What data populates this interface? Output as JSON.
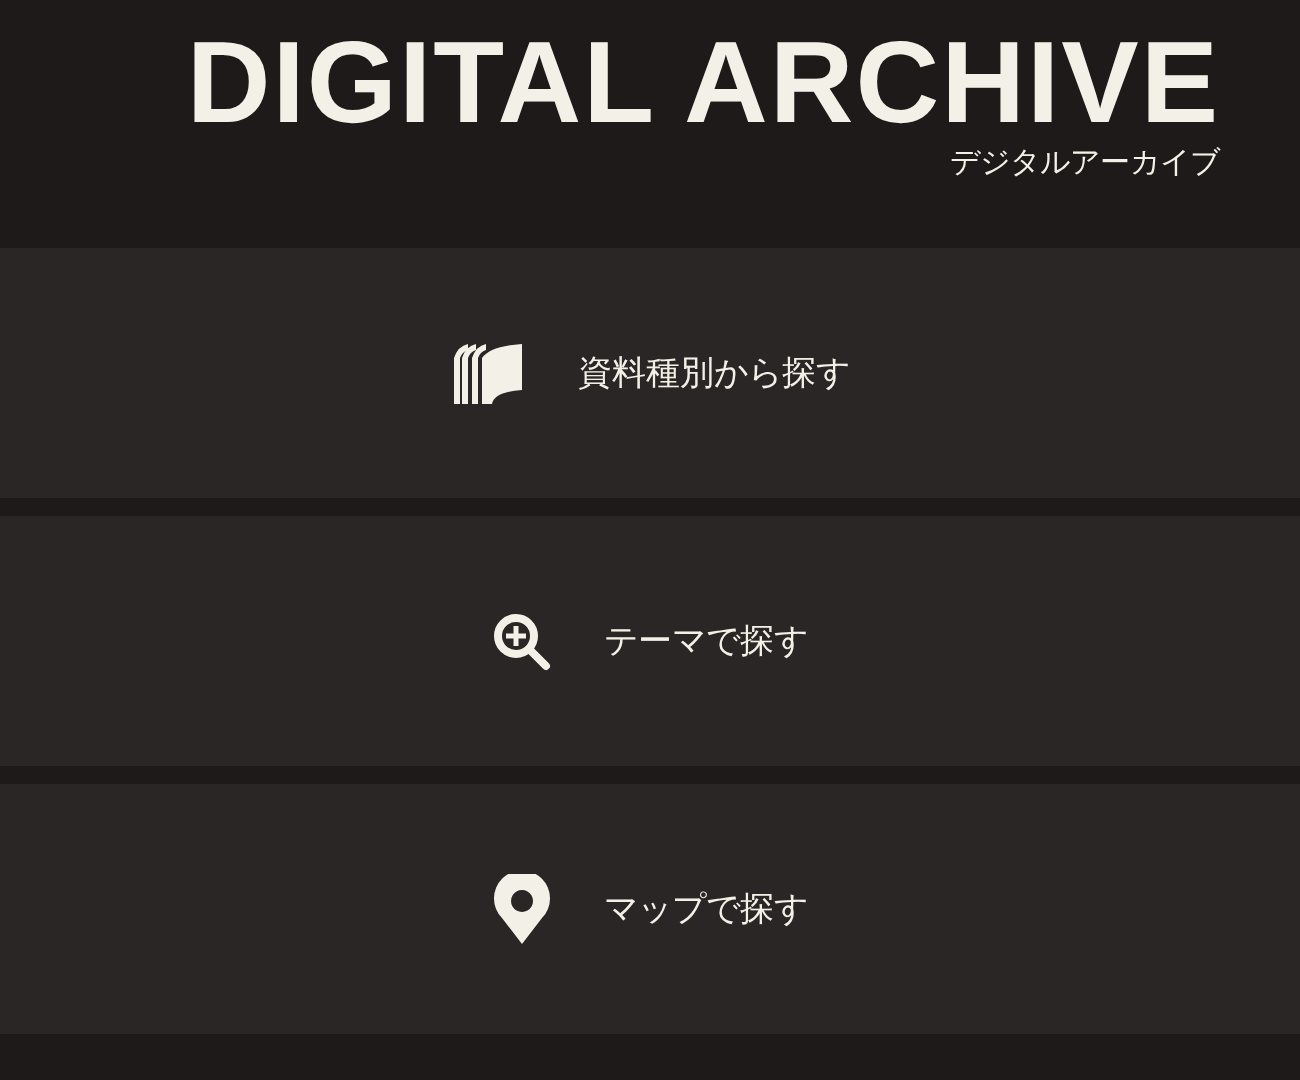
{
  "header": {
    "title": "DIGITAL ARCHIVE",
    "subtitle": "デジタルアーカイブ"
  },
  "menu": [
    {
      "kind": "books",
      "label": "資料種別から探す"
    },
    {
      "kind": "zoom",
      "label": "テーマで探す"
    },
    {
      "kind": "pin",
      "label": "マップで探す"
    }
  ]
}
